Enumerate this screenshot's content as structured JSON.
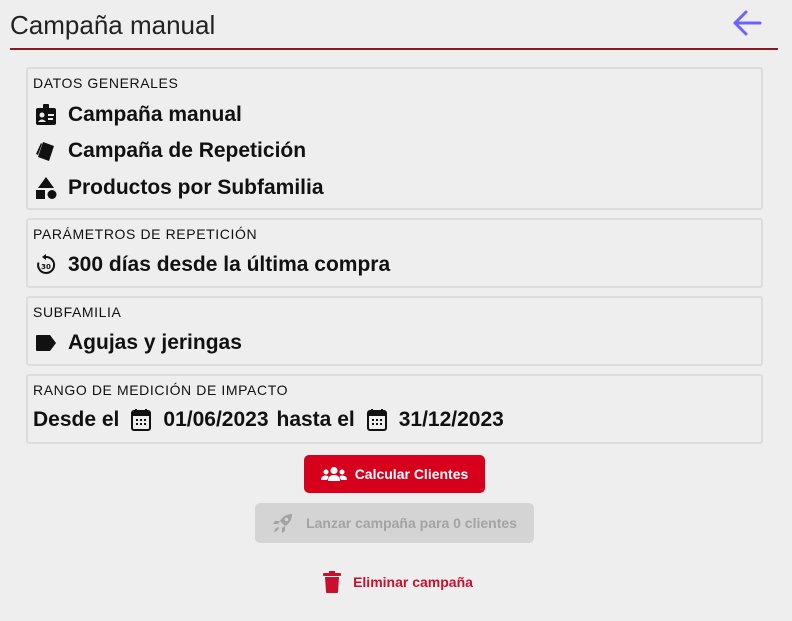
{
  "header": {
    "title": "Campaña manual"
  },
  "datos_generales": {
    "title": "DATOS GENERALES",
    "items": [
      {
        "icon": "id-badge-icon",
        "label": "Campaña manual"
      },
      {
        "icon": "tags-icon",
        "label": "Campaña de Repetición"
      },
      {
        "icon": "shapes-icon",
        "label": "Productos por Subfamilia"
      }
    ]
  },
  "parametros": {
    "title": "PARÁMETROS DE REPETICIÓN",
    "value": "300 días desde la última compra"
  },
  "subfamilia": {
    "title": "SUBFAMILIA",
    "value": "Agujas y jeringas"
  },
  "rango": {
    "title": "RANGO DE MEDICIÓN DE IMPACTO",
    "desde_label": "Desde el",
    "desde_value": "01/06/2023",
    "hasta_label": "hasta el",
    "hasta_value": "31/12/2023"
  },
  "actions": {
    "calcular": "Calcular Clientes",
    "lanzar": "Lanzar campaña para 0 clientes",
    "eliminar": "Eliminar campaña"
  },
  "colors": {
    "accent": "#d6001c",
    "header_rule": "#8b1a1f",
    "back_arrow": "#6c63ff",
    "disabled_bg": "#d4d4d4"
  }
}
